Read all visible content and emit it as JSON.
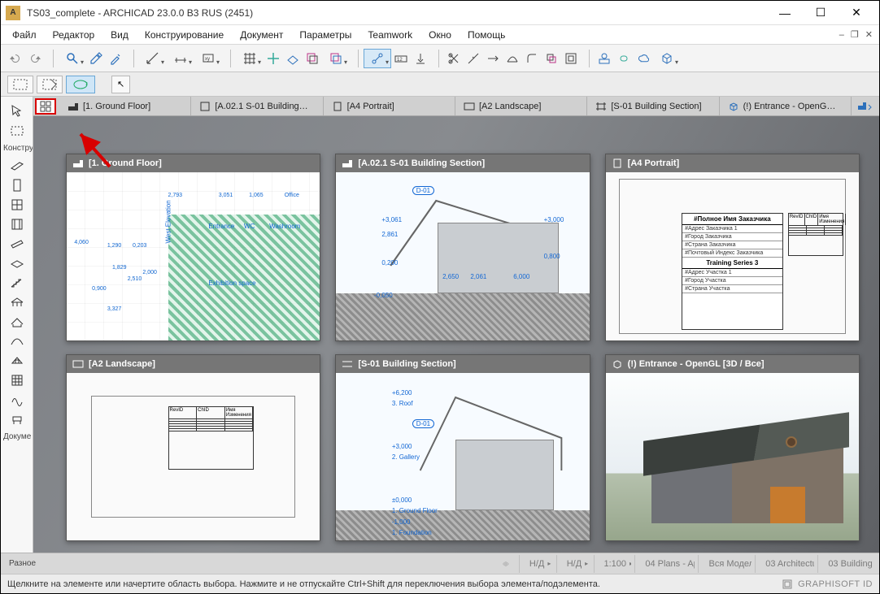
{
  "titlebar": {
    "title": "TS03_complete - ARCHICAD 23.0.0 B3 RUS (2451)",
    "app_icon_letter": "A",
    "min": "—",
    "max": "☐",
    "close": "✕"
  },
  "menubar": {
    "items": [
      "Файл",
      "Редактор",
      "Вид",
      "Конструирование",
      "Документ",
      "Параметры",
      "Teamwork",
      "Окно",
      "Помощь"
    ],
    "win_min": "–",
    "win_restore": "❐",
    "win_close": "✕"
  },
  "secondbar": {
    "arrow_cursor": "↖"
  },
  "left_panel": {
    "label_top": "Констру",
    "label_bottom": "Докуме",
    "label_footer": "Разное"
  },
  "tabs": [
    {
      "icon": "floor-icon",
      "label": "[1. Ground Floor]"
    },
    {
      "icon": "sheet-icon",
      "label": "[A.02.1 S-01 Building…"
    },
    {
      "icon": "sheet-icon",
      "label": "[A4 Portrait]"
    },
    {
      "icon": "sheet-icon",
      "label": "[A2 Landscape]"
    },
    {
      "icon": "section-icon",
      "label": "[S-01 Building Section]"
    },
    {
      "icon": "cube-icon",
      "label": "(!) Entrance - OpenG…"
    }
  ],
  "thumbs": [
    {
      "icon": "floor-icon",
      "label": "[1. Ground Floor]",
      "kind": "plan"
    },
    {
      "icon": "section-icon",
      "label": "[A.02.1 S-01 Building Section]",
      "kind": "section"
    },
    {
      "icon": "sheet-icon",
      "label": "[A4 Portrait]",
      "kind": "layout_portrait"
    },
    {
      "icon": "sheet-icon",
      "label": "[A2 Landscape]",
      "kind": "layout_landscape"
    },
    {
      "icon": "section-icon",
      "label": "[S-01 Building Section]",
      "kind": "section2"
    },
    {
      "icon": "cube-icon",
      "label": "(!) Entrance - OpenGL [3D / Все]",
      "kind": "render"
    }
  ],
  "ground_floor": {
    "areas": [
      "Entrance",
      "WC",
      "Washroom",
      "Exhibition space"
    ],
    "west": "West Elevation",
    "dims": [
      "4,060",
      "3,051",
      "0,203",
      "2,793",
      "1,829",
      "0,900",
      "2,000",
      "1,290",
      "2,510",
      "1,065",
      "3,327",
      "Office"
    ]
  },
  "section": {
    "marker": "D-01",
    "dims": [
      "+3,061",
      "2,861",
      "0,200",
      "-0,050",
      "2,650",
      "2,061",
      "+3,000",
      "0,800",
      "6,000"
    ]
  },
  "section2": {
    "marker": "D-01",
    "dims": [
      "+6,200",
      "3. Roof",
      "+3,000",
      "2. Gallery",
      "±0,000",
      "1. Ground Floor",
      "-1,000",
      "1. Foundation"
    ]
  },
  "layout_a4": {
    "client_title": "#Полное Имя Заказчика",
    "rows": [
      "#Адрес Заказчика 1",
      "#Город Заказчика",
      "#Страна Заказчика",
      "#Почтовый Индекс Заказчика"
    ],
    "project_title": "Training Series 3",
    "rows2": [
      "#Адрес Участка 1",
      "#Город Участка",
      "#Страна Участка"
    ],
    "rev_headers": [
      "RevID",
      "ChID",
      "Имя Изменения"
    ]
  },
  "layout_a2": {
    "rev_headers": [
      "RevID",
      "ChID",
      "Имя Изменения"
    ]
  },
  "bottombar": {
    "items": [
      {
        "icon": "eye-icon",
        "label": ""
      },
      {
        "icon": "",
        "label": "Н/Д"
      },
      {
        "icon": "layers-icon",
        "label": "Н/Д"
      },
      {
        "icon": "scale-icon",
        "label": "1:100"
      },
      {
        "icon": "stack-icon",
        "label": "04 Plans - Ap…"
      },
      {
        "icon": "model-icon",
        "label": "Вся Модель"
      },
      {
        "icon": "pen-icon",
        "label": "03 Architectu…"
      },
      {
        "icon": "view-icon",
        "label": "03 Building …"
      }
    ]
  },
  "statusbar": {
    "hint": "Щелкните на элементе или начертите область выбора. Нажмите и не отпускайте Ctrl+Shift для переключения выбора элемента/подэлемента.",
    "brand": "GRAPHISOFT ID"
  }
}
